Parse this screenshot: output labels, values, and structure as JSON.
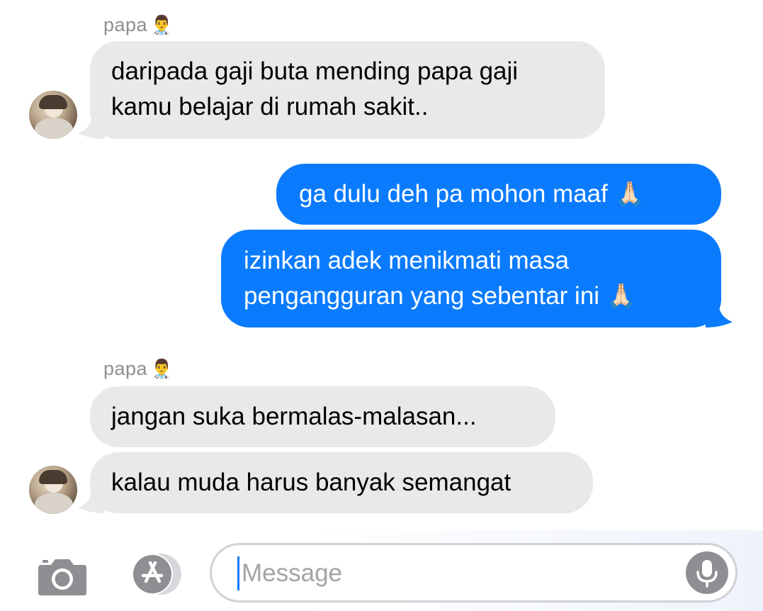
{
  "conversation": {
    "group1": {
      "sender": "papa",
      "sender_emoji": "👨‍⚕️",
      "message1_line1": "daripada gaji buta mending papa gaji",
      "message1_line2": "kamu belajar di rumah sakit.."
    },
    "outgoing": {
      "message1": "ga dulu deh pa mohon maaf",
      "message1_emoji": "🙏🏻",
      "message2_line1": "izinkan adek menikmati masa",
      "message2_line2": "pengangguran yang sebentar ini",
      "message2_emoji": "🙏🏻"
    },
    "group2": {
      "sender": "papa",
      "sender_emoji": "👨‍⚕️",
      "message1": "jangan suka bermalas-malasan...",
      "message2": "kalau muda harus banyak semangat"
    }
  },
  "input_bar": {
    "placeholder": "Message",
    "camera_icon": "camera-icon",
    "apps_icon": "app-store-icon",
    "mic_icon": "microphone-icon"
  },
  "colors": {
    "outgoing_bubble": "#0b7bfd",
    "incoming_bubble": "#e9e9eb",
    "sender_name": "#8e8e93"
  }
}
